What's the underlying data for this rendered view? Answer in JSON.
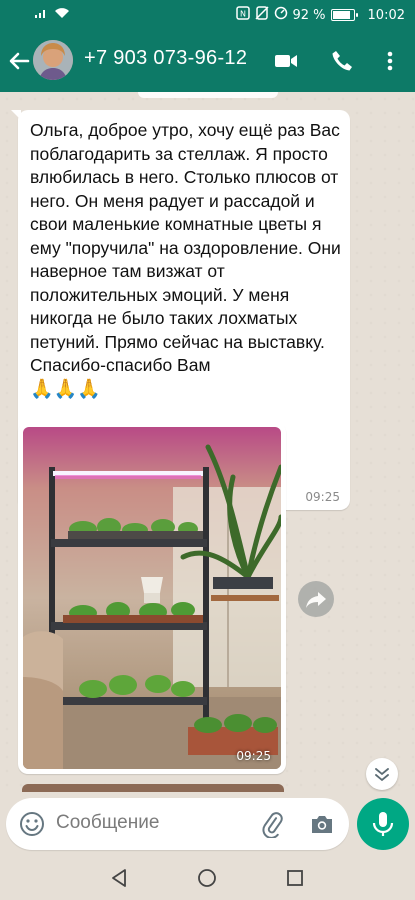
{
  "status_bar": {
    "battery_percent": "92 %",
    "time": "10:02",
    "battery_level": 0.92,
    "icons": [
      "signal-icon",
      "wifi-icon",
      "nfc-icon",
      "silent-icon",
      "data-saver-icon"
    ]
  },
  "header": {
    "contact_name": "+7 903 073-96-12",
    "icons": [
      "back-arrow-icon",
      "avatar",
      "video-call-icon",
      "phone-call-icon",
      "more-vert-icon"
    ]
  },
  "messages": [
    {
      "type": "text",
      "text": "Ольга, доброе утро, хочу ещё раз Вас поблагодарить за стеллаж. Я просто влюбилась в него. Столько плюсов от него. Он меня радует и рассадой и свои маленькие комнатные цветы я ему \"поручила\" на оздоровление. Они наверное там визжат от положительных эмоций. У меня никогда не было таких лохматых петуний. Прямо сейчас на выставку. Спасибо-спасибо Вам",
      "emoji": "🙏🙏🙏",
      "time": "09:25"
    },
    {
      "type": "image",
      "time": "09:25"
    }
  ],
  "input": {
    "placeholder": "Сообщение",
    "icons": [
      "emoji-icon",
      "attach-clip-icon",
      "camera-icon",
      "mic-icon"
    ]
  },
  "nav": {
    "icons": [
      "nav-back-icon",
      "nav-home-icon",
      "nav-recents-icon"
    ]
  },
  "colors": {
    "header": "#0d7a67",
    "chat_bg": "#e6dfd6",
    "accent": "#00a884",
    "bubble": "#ffffff",
    "time": "#8a8a8a"
  }
}
